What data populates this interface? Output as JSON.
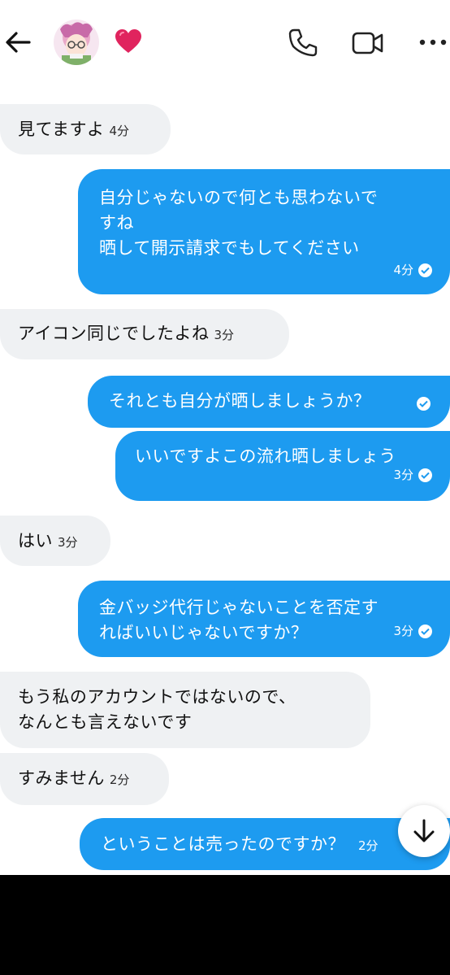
{
  "colors": {
    "incoming_bubble": "#eff1f3",
    "outgoing_bubble": "#1d9bf0",
    "heart": "#e0245e",
    "bottom_bar": "#000000"
  },
  "header": {
    "back_icon": "arrow-left-icon",
    "heart_icon": "heart-icon",
    "call_icon": "phone-icon",
    "video_icon": "video-camera-icon",
    "more_icon": "more-dots-icon"
  },
  "messages": [
    {
      "dir": "in",
      "text": "見てますよ",
      "time": "4分"
    },
    {
      "dir": "out",
      "text": "自分じゃないので何とも思わないで\nすね\n晒して開示請求でもしてください",
      "time": "4分"
    },
    {
      "dir": "in",
      "text": "アイコン同じでしたよね",
      "time": "3分"
    },
    {
      "dir": "out",
      "text": "それとも自分が晒しましょうか？",
      "time": ""
    },
    {
      "dir": "out",
      "text": "いいですよこの流れ晒しましょう",
      "time": "3分"
    },
    {
      "dir": "in",
      "text": "はい",
      "time": "3分"
    },
    {
      "dir": "out",
      "text": "金バッジ代行じゃないことを否定す\nればいいじゃないですか？",
      "time": "3分"
    },
    {
      "dir": "in",
      "text": "もう私のアカウントではないので、\nなんとも言えないです",
      "time": ""
    },
    {
      "dir": "in",
      "text": "すみません",
      "time": "2分"
    },
    {
      "dir": "out",
      "text": "ということは売ったのですか？",
      "time": "2分"
    }
  ],
  "scroll_button_icon": "arrow-down-icon"
}
